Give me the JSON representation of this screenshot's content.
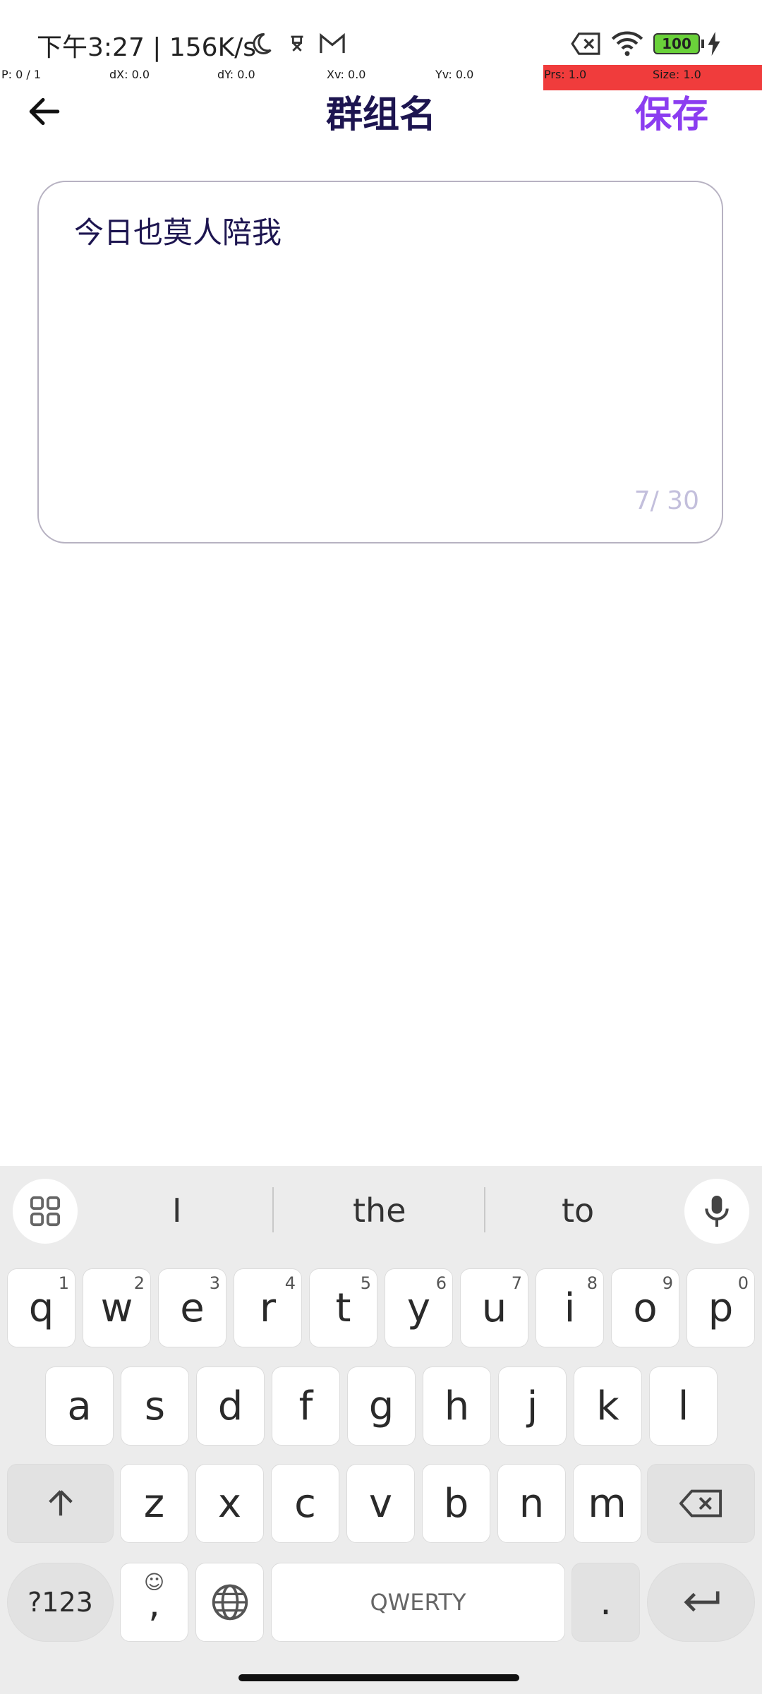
{
  "status": {
    "time": "下午3:27 | 156K/s",
    "battery": "100"
  },
  "debug": {
    "p": "P: 0 / 1",
    "dx": "dX: 0.0",
    "dy": "dY: 0.0",
    "xv": "Xv: 0.0",
    "yv": "Yv: 0.0",
    "prs": "Prs: 1.0",
    "size": "Size: 1.0"
  },
  "header": {
    "title": "群组名",
    "save_label": "保存"
  },
  "form": {
    "value": "今日也莫人陪我",
    "counter": "7/ 30"
  },
  "keyboard": {
    "suggestions": [
      "I",
      "the",
      "to"
    ],
    "row1": [
      {
        "k": "q",
        "h": "1"
      },
      {
        "k": "w",
        "h": "2"
      },
      {
        "k": "e",
        "h": "3"
      },
      {
        "k": "r",
        "h": "4"
      },
      {
        "k": "t",
        "h": "5"
      },
      {
        "k": "y",
        "h": "6"
      },
      {
        "k": "u",
        "h": "7"
      },
      {
        "k": "i",
        "h": "8"
      },
      {
        "k": "o",
        "h": "9"
      },
      {
        "k": "p",
        "h": "0"
      }
    ],
    "row2": [
      "a",
      "s",
      "d",
      "f",
      "g",
      "h",
      "j",
      "k",
      "l"
    ],
    "row3": [
      "z",
      "x",
      "c",
      "v",
      "b",
      "n",
      "m"
    ],
    "symbols_label": "?123",
    "comma_label": ",",
    "space_label": "QWERTY",
    "period_label": "."
  },
  "colors": {
    "accent": "#8b3df0",
    "title": "#1d1550",
    "debug_bg": "#f03c3c"
  }
}
